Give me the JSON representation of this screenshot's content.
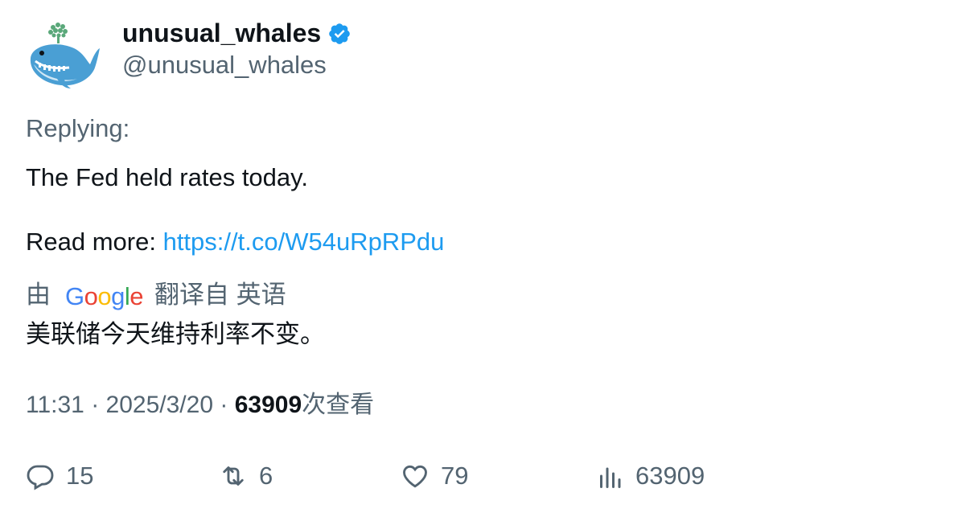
{
  "author": {
    "display_name": "unusual_whales",
    "handle": "@unusual_whales"
  },
  "tweet": {
    "replying_label": "Replying:",
    "text": "The Fed held rates today.",
    "read_more_label": "Read more: ",
    "link": "https://t.co/W54uRpRPdu"
  },
  "translation": {
    "by_label": "由",
    "provider_letters": [
      "G",
      "o",
      "o",
      "g",
      "l",
      "e"
    ],
    "from_label": "翻译自 英语",
    "text": "美联储今天维持利率不变。"
  },
  "meta": {
    "time": "11:31",
    "separator": "·",
    "date": "2025/3/20",
    "views_count": "63909",
    "views_label": "次查看"
  },
  "actions": {
    "reply_count": "15",
    "retweet_count": "6",
    "like_count": "79",
    "views_count": "63909"
  },
  "colors": {
    "link": "#1d9bf0",
    "secondary_text": "#536471",
    "primary_text": "#0f1419",
    "verified": "#1d9bf0"
  }
}
